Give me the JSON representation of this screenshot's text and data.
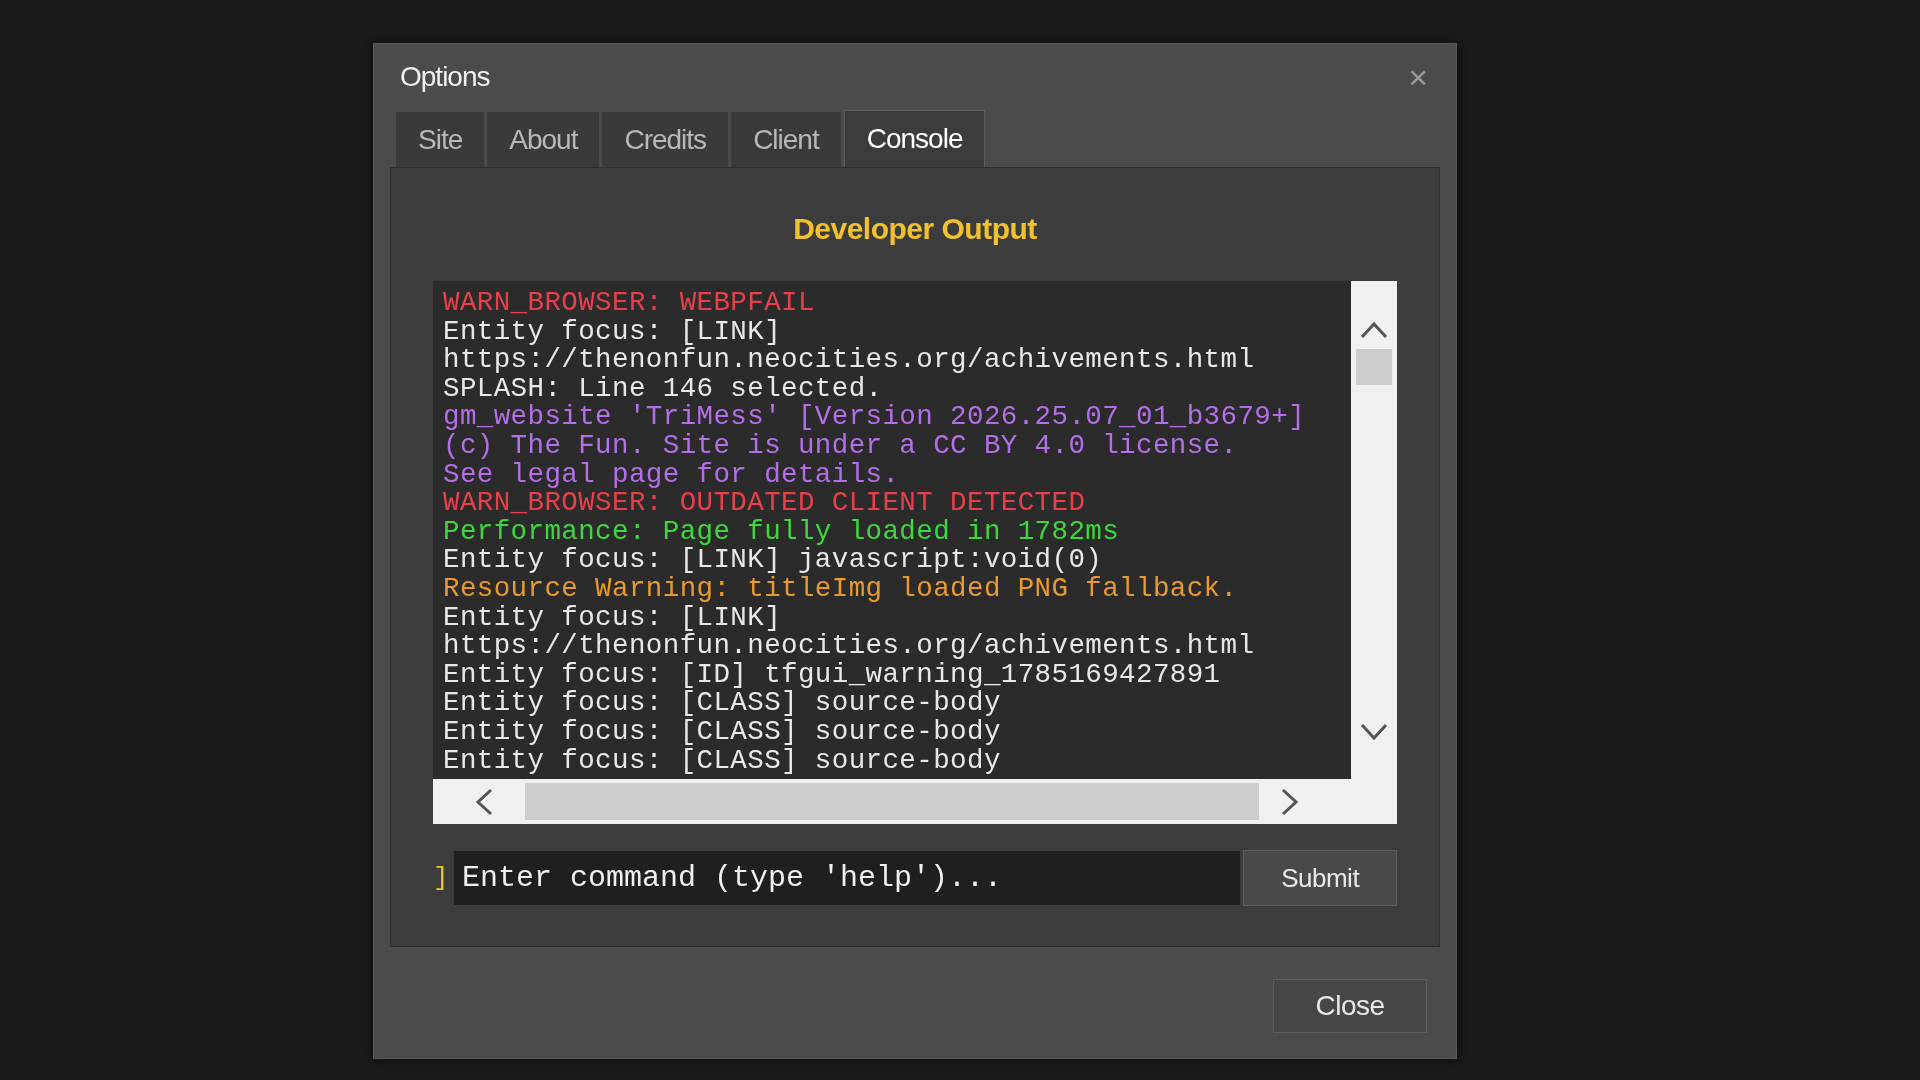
{
  "window": {
    "title": "Options",
    "close_icon": "×"
  },
  "tabs": [
    {
      "label": "Site",
      "selected": false
    },
    {
      "label": "About",
      "selected": false
    },
    {
      "label": "Credits",
      "selected": false
    },
    {
      "label": "Client",
      "selected": false
    },
    {
      "label": "Console",
      "selected": true
    }
  ],
  "console": {
    "heading": "Developer Output",
    "lines": [
      {
        "kind": "error",
        "text": "WARN_BROWSER: WEBPFAIL"
      },
      {
        "kind": "info",
        "text": "Entity focus: [LINK]"
      },
      {
        "kind": "info",
        "text": "https://thenonfun.neocities.org/achivements.html"
      },
      {
        "kind": "info",
        "text": "SPLASH: Line 146 selected."
      },
      {
        "kind": "meta",
        "text": "gm_website 'TriMess' [Version 2026.25.07_01_b3679+]"
      },
      {
        "kind": "meta",
        "text": "(c) The Fun. Site is under a CC BY 4.0 license."
      },
      {
        "kind": "meta",
        "text": "See legal page for details."
      },
      {
        "kind": "error",
        "text": "WARN_BROWSER: OUTDATED CLIENT DETECTED"
      },
      {
        "kind": "success",
        "text": "Performance: Page fully loaded in 1782ms"
      },
      {
        "kind": "info",
        "text": "Entity focus: [LINK] javascript:void(0)"
      },
      {
        "kind": "warn",
        "text": "Resource Warning: titleImg loaded PNG fallback."
      },
      {
        "kind": "info",
        "text": "Entity focus: [LINK]"
      },
      {
        "kind": "info",
        "text": "https://thenonfun.neocities.org/achivements.html"
      },
      {
        "kind": "info",
        "text": "Entity focus: [ID] tfgui_warning_1785169427891"
      },
      {
        "kind": "info",
        "text": "Entity focus: [CLASS] source-body"
      },
      {
        "kind": "info",
        "text": "Entity focus: [CLASS] source-body"
      },
      {
        "kind": "info",
        "text": "Entity focus: [CLASS] source-body"
      }
    ],
    "prompt": "]",
    "input": {
      "placeholder": "Enter command (type 'help')..."
    },
    "submit": "Submit"
  },
  "buttons": [
    "Close"
  ]
}
